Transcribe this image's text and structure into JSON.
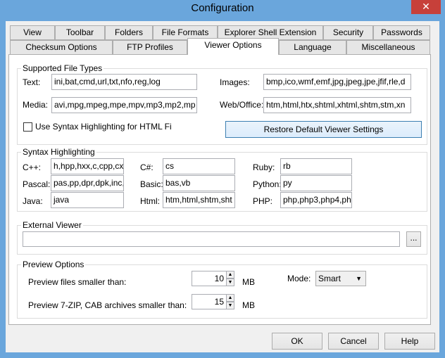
{
  "window": {
    "title": "Configuration",
    "close": "✕"
  },
  "tabs": {
    "row1": [
      "View",
      "Toolbar",
      "Folders",
      "File Formats",
      "Explorer Shell Extension",
      "Security",
      "Passwords"
    ],
    "row2": [
      "Checksum Options",
      "FTP Profiles",
      "Viewer Options",
      "Language",
      "Miscellaneous"
    ],
    "selected": "Viewer Options"
  },
  "supported": {
    "title": "Supported File Types",
    "text_label": "Text:",
    "text_value": "ini,bat,cmd,url,txt,nfo,reg,log",
    "images_label": "Images:",
    "images_value": "bmp,ico,wmf,emf,jpg,jpeg,jpe,jfif,rle,d",
    "media_label": "Media:",
    "media_value": "avi,mpg,mpeg,mpe,mpv,mp3,mp2,mp",
    "web_label": "Web/Office:",
    "web_value": "htm,html,htx,shtml,xhtml,shtm,stm,xn",
    "syntax_checkbox": "Use Syntax Highlighting for HTML Fi",
    "restore": "Restore Default Viewer Settings"
  },
  "syntax": {
    "title": "Syntax Highlighting",
    "items": [
      {
        "label": "C++:",
        "value": "h,hpp,hxx,c,cpp,cxx"
      },
      {
        "label": "C#:",
        "value": "cs"
      },
      {
        "label": "Ruby:",
        "value": "rb"
      },
      {
        "label": "Pascal:",
        "value": "pas,pp,dpr,dpk,inc,"
      },
      {
        "label": "Basic:",
        "value": "bas,vb"
      },
      {
        "label": "Python:",
        "value": "py"
      },
      {
        "label": "Java:",
        "value": "java"
      },
      {
        "label": "Html:",
        "value": "htm,html,shtm,sht"
      },
      {
        "label": "PHP:",
        "value": "php,php3,php4,ph"
      }
    ]
  },
  "external": {
    "title": "External Viewer",
    "value": "",
    "browse": "..."
  },
  "preview": {
    "title": "Preview Options",
    "files_label": "Preview files smaller than:",
    "files_value": "10",
    "unit1": "MB",
    "archives_label": "Preview 7-ZIP, CAB archives smaller than:",
    "archives_value": "15",
    "unit2": "MB",
    "mode_label": "Mode:",
    "mode_value": "Smart"
  },
  "buttons": {
    "ok": "OK",
    "cancel": "Cancel",
    "help": "Help"
  }
}
